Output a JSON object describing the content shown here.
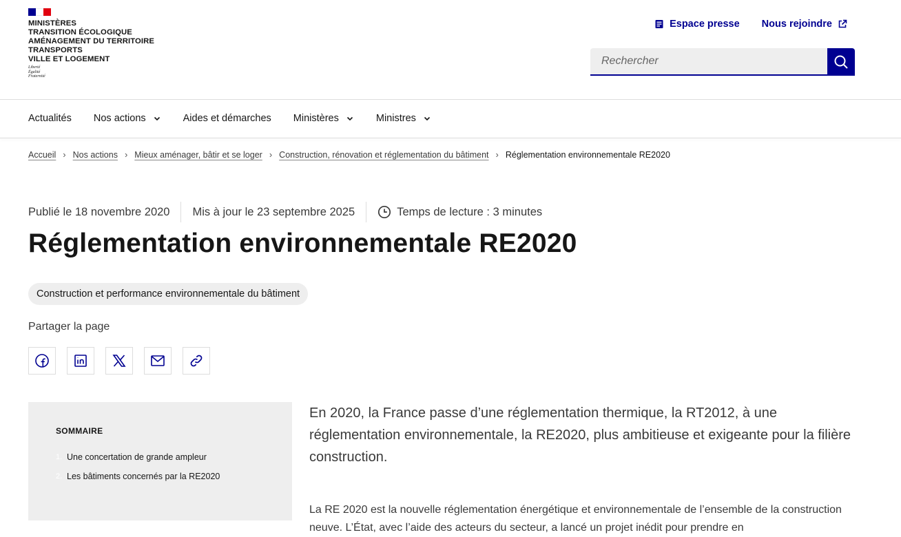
{
  "brand": {
    "lines": [
      "MINISTÈRES",
      "TRANSITION ÉCOLOGIQUE",
      "AMÉNAGEMENT DU TERRITOIRE",
      "TRANSPORTS",
      "VILLE ET LOGEMENT"
    ],
    "motto": [
      "Liberté",
      "Égalité",
      "Fraternité"
    ],
    "colors": {
      "blue": "#000091",
      "white": "#ffffff",
      "red": "#e1000f"
    }
  },
  "tools": {
    "press_label": "Espace presse",
    "join_label": "Nous rejoindre"
  },
  "search": {
    "placeholder": "Rechercher"
  },
  "nav": {
    "items": [
      {
        "label": "Actualités"
      },
      {
        "label": "Nos actions"
      },
      {
        "label": "Aides et démarches"
      },
      {
        "label": "Ministères"
      },
      {
        "label": "Ministres"
      }
    ]
  },
  "breadcrumb": {
    "items": [
      "Accueil",
      "Nos actions",
      "Mieux aménager, bâtir et se loger",
      "Construction, rénovation et réglementation du bâtiment"
    ],
    "current": "Réglementation environnementale RE2020"
  },
  "meta": {
    "published": "Publié le 18 novembre 2020",
    "updated": "Mis à jour le 23 septembre 2025",
    "reading_time": "Temps de lecture : 3 minutes"
  },
  "title": "Réglementation environnementale RE2020",
  "tag": "Construction et performance environnementale du bâtiment",
  "share": {
    "label": "Partager la page",
    "icons": [
      "facebook-icon",
      "linkedin-icon",
      "x-icon",
      "mail-icon",
      "link-icon"
    ]
  },
  "summary": {
    "title": "SOMMAIRE",
    "items": [
      {
        "num": "1.",
        "label": "Une concertation de grande ampleur"
      },
      {
        "num": "2.",
        "label": "Les bâtiments concernés par la RE2020"
      }
    ]
  },
  "article": {
    "lead": "En 2020, la France passe d’une réglementation thermique, la RT2012, à une réglementation environnementale, la RE2020, plus ambitieuse et exigeante pour la filière construction.",
    "body": "La RE 2020 est la nouvelle réglementation énergétique et environnementale de l’ensemble de la construction neuve. L’État, avec l’aide des acteurs du secteur, a lancé un projet inédit pour prendre en"
  }
}
